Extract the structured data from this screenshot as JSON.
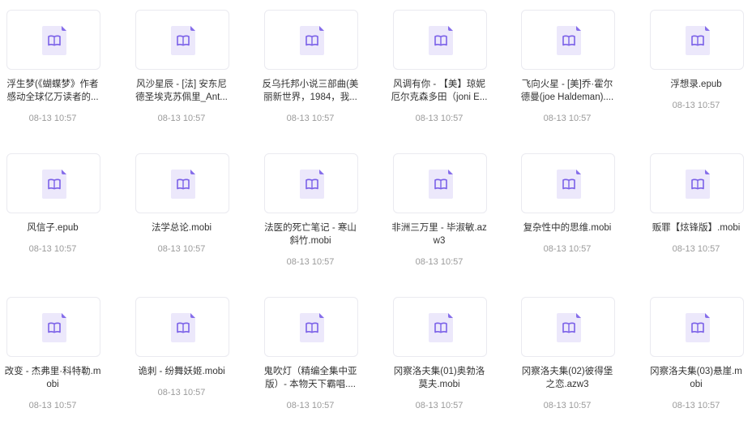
{
  "files": [
    {
      "name_lines": [
        "浮生梦(《蝴蝶梦》作者",
        "感动全球亿万读者的..."
      ],
      "time": "08-13 10:57"
    },
    {
      "name_lines": [
        "风沙星辰 - [法] 安东尼",
        "德圣埃克苏佩里_Ant..."
      ],
      "time": "08-13 10:57"
    },
    {
      "name_lines": [
        "反乌托邦小说三部曲(美",
        "丽新世界，1984，我..."
      ],
      "time": "08-13 10:57"
    },
    {
      "name_lines": [
        "风调有你 - 【美】琼妮",
        "厄尔克森多田（joni E..."
      ],
      "time": "08-13 10:57"
    },
    {
      "name_lines": [
        "飞向火星 - [美]乔·霍尔",
        "德曼(joe Haldeman)...."
      ],
      "time": "08-13 10:57"
    },
    {
      "name_lines": [
        "浮想录.epub"
      ],
      "time": "08-13 10:57"
    },
    {
      "name_lines": [
        "风信子.epub"
      ],
      "time": "08-13 10:57"
    },
    {
      "name_lines": [
        "法学总论.mobi"
      ],
      "time": "08-13 10:57"
    },
    {
      "name_lines": [
        "法医的死亡笔记 - 寒山",
        "斜竹.mobi"
      ],
      "time": "08-13 10:57"
    },
    {
      "name_lines": [
        "非洲三万里 - 毕淑敏.az",
        "w3"
      ],
      "time": "08-13 10:57"
    },
    {
      "name_lines": [
        "复杂性中的思维.mobi"
      ],
      "time": "08-13 10:57"
    },
    {
      "name_lines": [
        "贩罪【炫锋版】.mobi"
      ],
      "time": "08-13 10:57"
    },
    {
      "name_lines": [
        "改变 - 杰弗里·科特勒.m",
        "obi"
      ],
      "time": "08-13 10:57"
    },
    {
      "name_lines": [
        "诡刺 - 纷舞妖姬.mobi"
      ],
      "time": "08-13 10:57"
    },
    {
      "name_lines": [
        "鬼吹灯（精编全集中亚",
        "版）- 本物天下霸唱...."
      ],
      "time": "08-13 10:57"
    },
    {
      "name_lines": [
        "冈察洛夫集(01)奥勃洛",
        "莫夫.mobi"
      ],
      "time": "08-13 10:57"
    },
    {
      "name_lines": [
        "冈察洛夫集(02)彼得堡",
        "之恋.azw3"
      ],
      "time": "08-13 10:57"
    },
    {
      "name_lines": [
        "冈察洛夫集(03)悬崖.m",
        "obi"
      ],
      "time": "08-13 10:57"
    }
  ],
  "icon": {
    "name": "book-file-icon",
    "color": "#7b61e8",
    "bg": "#ece8fb"
  }
}
